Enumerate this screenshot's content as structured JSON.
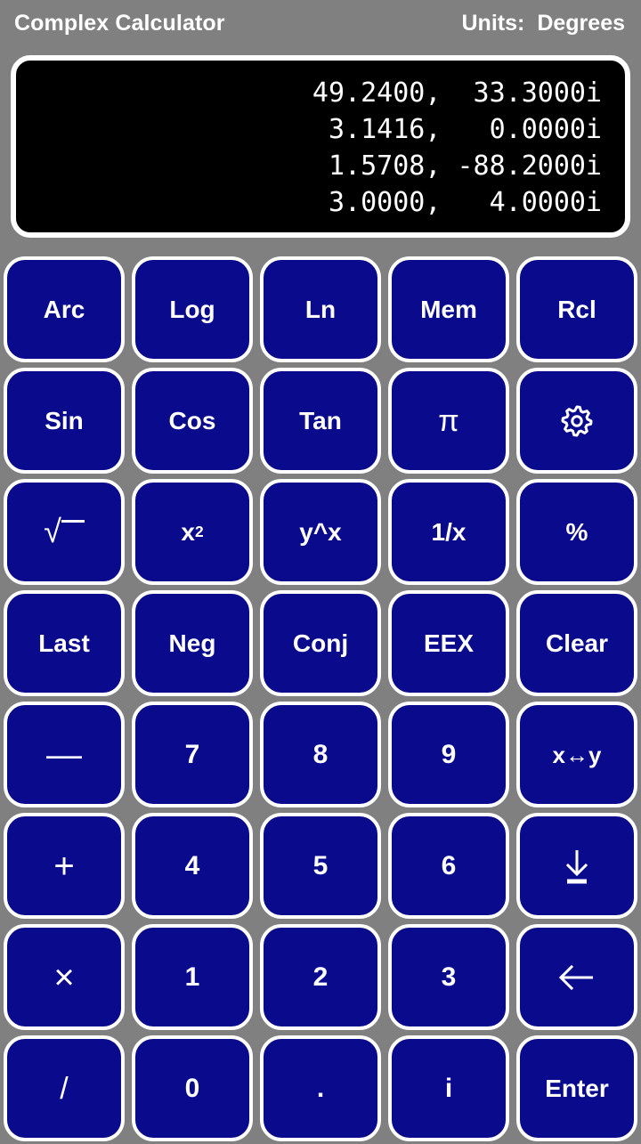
{
  "header": {
    "title": "Complex Calculator",
    "units_label": "Units:",
    "units_value": "Degrees"
  },
  "display": {
    "lines": [
      "49.2400,  33.3000i",
      " 3.1416,   0.0000i",
      " 1.5708, -88.2000i",
      " 3.0000,   4.0000i"
    ],
    "background": "#000000",
    "text_color": "#ffffff"
  },
  "theme": {
    "background": "#808080",
    "key_fill": "#0A0A8C",
    "key_border": "#ffffff",
    "text_color": "#ffffff"
  },
  "keypad": {
    "rows": [
      {
        "keys": [
          {
            "name": "key-arc",
            "label": "Arc",
            "kind": "text"
          },
          {
            "name": "key-log",
            "label": "Log",
            "kind": "text"
          },
          {
            "name": "key-ln",
            "label": "Ln",
            "kind": "text"
          },
          {
            "name": "key-mem",
            "label": "Mem",
            "kind": "text"
          },
          {
            "name": "key-rcl",
            "label": "Rcl",
            "kind": "text"
          }
        ]
      },
      {
        "keys": [
          {
            "name": "key-sin",
            "label": "Sin",
            "kind": "text"
          },
          {
            "name": "key-cos",
            "label": "Cos",
            "kind": "text"
          },
          {
            "name": "key-tan",
            "label": "Tan",
            "kind": "text"
          },
          {
            "name": "key-pi",
            "label": "π",
            "kind": "symbol"
          },
          {
            "name": "key-settings",
            "label": "",
            "kind": "gear-icon"
          }
        ]
      },
      {
        "keys": [
          {
            "name": "key-sqrt",
            "label": "√",
            "kind": "sqrt"
          },
          {
            "name": "key-x-squared",
            "label": "x2",
            "kind": "superscript",
            "base": "x",
            "exponent": "2"
          },
          {
            "name": "key-y-pow-x",
            "label": "y^x",
            "kind": "text"
          },
          {
            "name": "key-reciprocal",
            "label": "1/x",
            "kind": "text"
          },
          {
            "name": "key-percent",
            "label": "%",
            "kind": "text"
          }
        ]
      },
      {
        "keys": [
          {
            "name": "key-last",
            "label": "Last",
            "kind": "text"
          },
          {
            "name": "key-neg",
            "label": "Neg",
            "kind": "text"
          },
          {
            "name": "key-conj",
            "label": "Conj",
            "kind": "text"
          },
          {
            "name": "key-eex",
            "label": "EEX",
            "kind": "text"
          },
          {
            "name": "key-clear",
            "label": "Clear",
            "kind": "text"
          }
        ]
      },
      {
        "keys": [
          {
            "name": "key-subtract",
            "label": "—",
            "kind": "symbol-big"
          },
          {
            "name": "key-7",
            "label": "7",
            "kind": "digit"
          },
          {
            "name": "key-8",
            "label": "8",
            "kind": "digit"
          },
          {
            "name": "key-9",
            "label": "9",
            "kind": "digit"
          },
          {
            "name": "key-swap-xy",
            "label": "x↔y",
            "kind": "text-small"
          }
        ]
      },
      {
        "keys": [
          {
            "name": "key-add",
            "label": "+",
            "kind": "symbol-big"
          },
          {
            "name": "key-4",
            "label": "4",
            "kind": "digit"
          },
          {
            "name": "key-5",
            "label": "5",
            "kind": "digit"
          },
          {
            "name": "key-6",
            "label": "6",
            "kind": "digit"
          },
          {
            "name": "key-roll-down",
            "label": "",
            "kind": "arrow-down-bar-icon"
          }
        ]
      },
      {
        "keys": [
          {
            "name": "key-multiply",
            "label": "×",
            "kind": "symbol-big"
          },
          {
            "name": "key-1",
            "label": "1",
            "kind": "digit"
          },
          {
            "name": "key-2",
            "label": "2",
            "kind": "digit"
          },
          {
            "name": "key-3",
            "label": "3",
            "kind": "digit"
          },
          {
            "name": "key-backspace",
            "label": "",
            "kind": "arrow-left-icon"
          }
        ]
      },
      {
        "keys": [
          {
            "name": "key-divide",
            "label": "/",
            "kind": "symbol"
          },
          {
            "name": "key-0",
            "label": "0",
            "kind": "digit"
          },
          {
            "name": "key-decimal",
            "label": ".",
            "kind": "digit"
          },
          {
            "name": "key-i",
            "label": "i",
            "kind": "digit"
          },
          {
            "name": "key-enter",
            "label": "Enter",
            "kind": "text"
          }
        ]
      }
    ]
  }
}
